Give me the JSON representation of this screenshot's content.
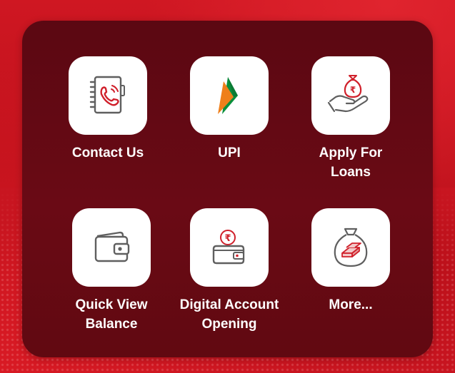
{
  "tiles": [
    {
      "label": "Contact Us",
      "icon": "contact-book-phone-icon"
    },
    {
      "label": "UPI",
      "icon": "upi-logo-icon"
    },
    {
      "label": "Apply For Loans",
      "icon": "hand-money-bag-icon"
    },
    {
      "label": "Quick View Balance",
      "icon": "wallet-icon"
    },
    {
      "label": "Digital Account Opening",
      "icon": "rupee-bag-icon"
    },
    {
      "label": "More...",
      "icon": "gold-bag-icon"
    }
  ],
  "colors": {
    "background": "#c4121c",
    "panel": "#5b0812",
    "tile": "#ffffff",
    "label": "#ffffff",
    "icon_red": "#d0202b",
    "icon_grey": "#5f5f5f",
    "upi_orange": "#ef7f1a",
    "upi_green": "#0a8f3c"
  }
}
